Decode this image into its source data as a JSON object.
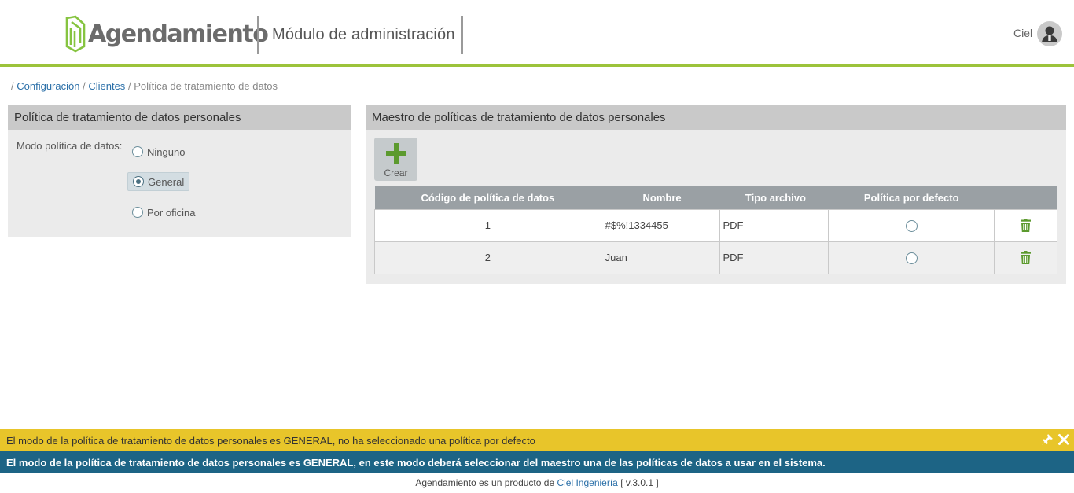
{
  "header": {
    "logo_text": "Agendamiento",
    "module_title": "Módulo de administración",
    "user_name": "Ciel"
  },
  "breadcrumb": {
    "sep": "/",
    "items": [
      "Configuración",
      "Clientes",
      "Política de tratamiento de datos"
    ]
  },
  "left_panel": {
    "title": "Política de tratamiento de datos personales",
    "mode_label": "Modo política de datos:",
    "options": [
      "Ninguno",
      "General",
      "Por oficina"
    ],
    "selected": "General"
  },
  "right_panel": {
    "title": "Maestro de políticas de tratamiento de datos personales",
    "create_label": "Crear",
    "columns": [
      "Código de política de datos",
      "Nombre",
      "Tipo archivo",
      "Política por defecto",
      ""
    ],
    "rows": [
      {
        "code": "1",
        "name": "#$%!1334455",
        "type": "PDF"
      },
      {
        "code": "2",
        "name": "Juan",
        "type": "PDF"
      }
    ]
  },
  "warning_bar": {
    "text": "El modo de la política de tratamiento de datos personales es GENERAL, no ha seleccionado una política por defecto"
  },
  "info_bar": {
    "text": "El modo de la política de tratamiento de datos personales es GENERAL, en este modo deberá seleccionar del maestro una de las políticas de datos a usar en el sistema."
  },
  "footer": {
    "prefix": "Agendamiento es un producto de",
    "company": "Ciel Ingeniería",
    "version": "[ v.3.0.1 ]"
  },
  "colors": {
    "accent_green": "#9cc33b",
    "icon_green": "#5c9a2e",
    "warning_yellow": "#e8c52a",
    "info_blue": "#1d6485",
    "link_blue": "#2a6fa8"
  },
  "icons": [
    "logo-icon",
    "user-avatar-icon",
    "plus-icon",
    "radio-icon",
    "trash-icon",
    "pin-icon",
    "close-icon"
  ]
}
